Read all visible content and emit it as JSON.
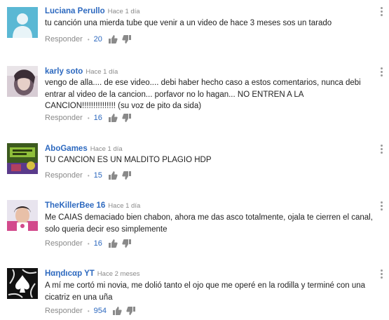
{
  "comments": [
    {
      "author": "Luciana Perullo",
      "time": "Hace 1 día",
      "text": "tu canción una  mierda tube que venir a un video de hace 3 meses sos un tarado",
      "reply_label": "Responder",
      "likes": "20",
      "avatar": "default-user-avatar"
    },
    {
      "author": "karly soto",
      "time": "Hace 1 día",
      "text": "vengo de alla.... de ese video.... debi haber hecho caso a estos comentarios, nunca debi entrar al video de la cancion... porfavor no lo hagan... NO ENTREN A LA CANCION!!!!!!!!!!!!!!! (su voz de pito da sida)",
      "reply_label": "Responder",
      "likes": "16",
      "avatar": "photo-avatar"
    },
    {
      "author": "AboGames",
      "time": "Hace 1 día",
      "text": "TU CANCION ES UN MALDITO PLAGIO HDP",
      "reply_label": "Responder",
      "likes": "15",
      "avatar": "game-avatar"
    },
    {
      "author": "TheKillerBee 16",
      "time": "Hace 1 día",
      "text": "Me CAIAS demaciado bien chabon, ahora me das asco totalmente, ojala te cierren el canal, solo queria decir eso simplemente",
      "reply_label": "Responder",
      "likes": "16",
      "avatar": "photo-avatar"
    },
    {
      "author": "Hαηdιcαp YT",
      "time": "Hace 2 meses",
      "text": "A mí me cortó mi novia, me dolió tanto el ojo que me operé en la rodilla y terminé con una cicatriz en una uña",
      "reply_label": "Responder",
      "likes": "954",
      "avatar": "spade-avatar"
    }
  ],
  "colors": {
    "author": "#2d69bf",
    "likes": "#2d69bf",
    "meta": "#8a8a8a",
    "text": "#222222",
    "default_avatar_bg": "#5ab8d4"
  },
  "icons": [
    "thumb-up-icon",
    "thumb-down-icon",
    "more-menu-icon"
  ]
}
